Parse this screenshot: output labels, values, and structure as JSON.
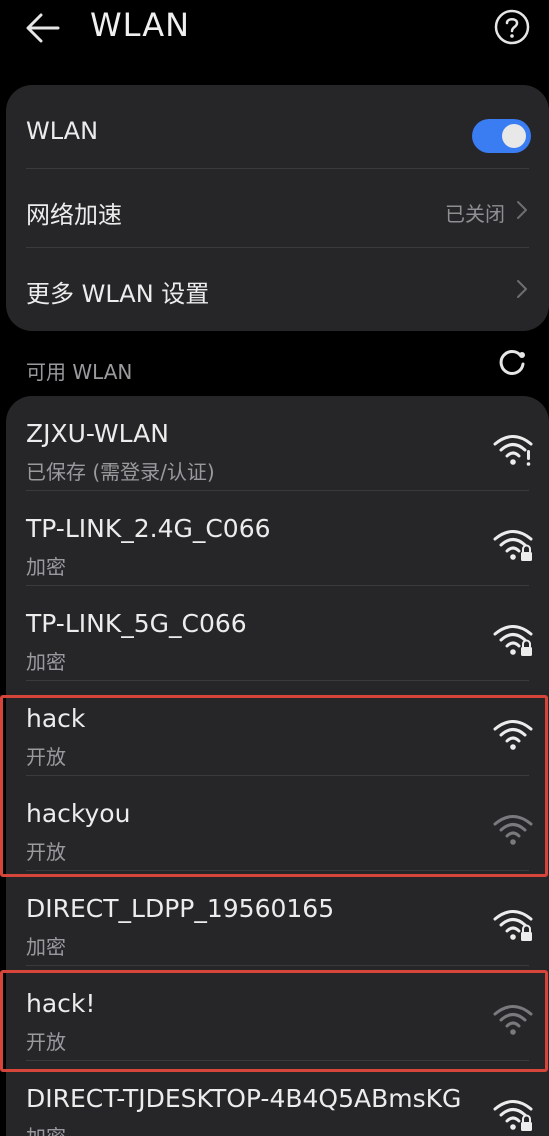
{
  "header": {
    "title": "WLAN",
    "back_icon": "arrow-left-icon",
    "help_icon": "question-circle-icon"
  },
  "settings": {
    "wlan_label": "WLAN",
    "wlan_enabled": true,
    "accel_label": "网络加速",
    "accel_value": "已关闭",
    "more_label": "更多 WLAN 设置"
  },
  "available": {
    "label": "可用 WLAN",
    "refresh_icon": "refresh-icon"
  },
  "networks": [
    {
      "ssid": "ZJXU-WLAN",
      "status": "已保存 (需登录/认证)",
      "icon": "wifi-alert-icon"
    },
    {
      "ssid": "TP-LINK_2.4G_C066",
      "status": "加密",
      "icon": "wifi-lock-icon"
    },
    {
      "ssid": "TP-LINK_5G_C066",
      "status": "加密",
      "icon": "wifi-lock-icon"
    },
    {
      "ssid": "hack",
      "status": "开放",
      "icon": "wifi-icon"
    },
    {
      "ssid": "hackyou",
      "status": "开放",
      "icon": "wifi-weak-icon"
    },
    {
      "ssid": "DIRECT_LDPP_19560165",
      "status": "加密",
      "icon": "wifi-lock-icon"
    },
    {
      "ssid": "hack!",
      "status": "开放",
      "icon": "wifi-weak-icon"
    },
    {
      "ssid": "DIRECT-TJDESKTOP-4B4Q5ABmsKG",
      "status": "加密",
      "icon": "wifi-lock-icon"
    }
  ],
  "colors": {
    "accent": "#3a7cf2",
    "highlight": "#d6453a",
    "card": "#262628",
    "background": "#000000"
  }
}
